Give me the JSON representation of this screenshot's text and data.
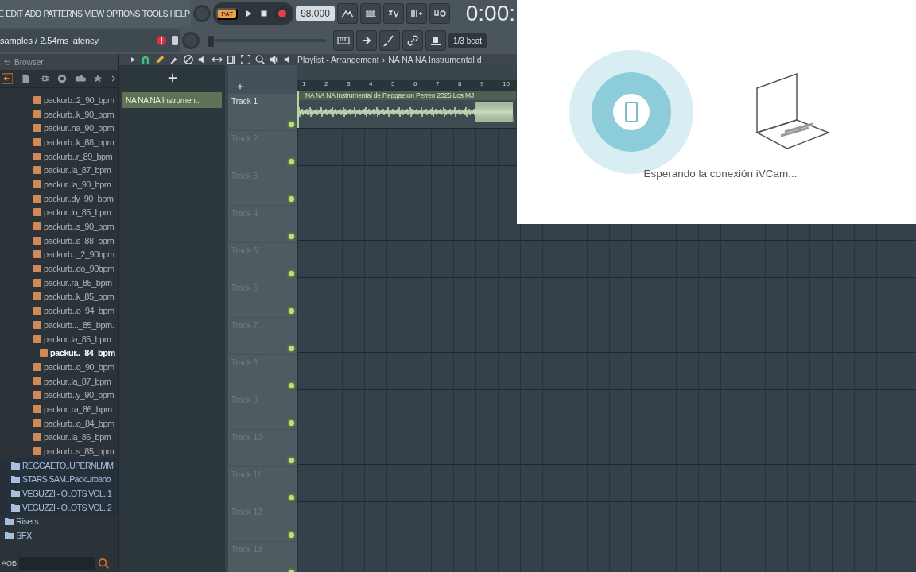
{
  "menu": {
    "items": [
      "E",
      "EDIT",
      "ADD",
      "PATTERNS",
      "VIEW",
      "OPTIONS",
      "TOOLS",
      "HELP"
    ]
  },
  "hint_bar": {
    "text": "samples / 2.54ms latency"
  },
  "master_slider": {
    "level": 0.0
  },
  "transport": {
    "mode": "PAT",
    "tempo": "98.000",
    "time": "0:00:",
    "snap": "1/3 beat"
  },
  "browser": {
    "title": "Browser",
    "search": "AOB",
    "items": [
      {
        "kind": "sample",
        "label": "packurb..2_90_bpm",
        "selected": false
      },
      {
        "kind": "sample",
        "label": "packurb..k_90_bpm",
        "selected": false
      },
      {
        "kind": "sample",
        "label": "packur..na_90_bpm",
        "selected": false
      },
      {
        "kind": "sample",
        "label": "packurb..k_88_bpm",
        "selected": false
      },
      {
        "kind": "sample",
        "label": "packurb..r_89_bpm",
        "selected": false
      },
      {
        "kind": "sample",
        "label": "packur..la_87_bpm",
        "selected": false
      },
      {
        "kind": "sample",
        "label": "packur..la_90_bpm",
        "selected": false
      },
      {
        "kind": "sample",
        "label": "packur..dy_90_bpm",
        "selected": false
      },
      {
        "kind": "sample",
        "label": "packur..lo_85_bpm",
        "selected": false
      },
      {
        "kind": "sample",
        "label": "packurb..s_90_bpm",
        "selected": false
      },
      {
        "kind": "sample",
        "label": "packurb..s_88_bpm",
        "selected": false
      },
      {
        "kind": "sample",
        "label": "packurb.._2_90bpm",
        "selected": false
      },
      {
        "kind": "sample",
        "label": "packurb..do_90bpm",
        "selected": false
      },
      {
        "kind": "sample",
        "label": "packur..ra_85_bpm",
        "selected": false
      },
      {
        "kind": "sample",
        "label": "packurb..k_85_bpm",
        "selected": false
      },
      {
        "kind": "sample",
        "label": "packurb..o_94_bpm",
        "selected": false
      },
      {
        "kind": "sample",
        "label": "packurb..._85_bpm.",
        "selected": false
      },
      {
        "kind": "sample",
        "label": "packur..la_85_bpm",
        "selected": false
      },
      {
        "kind": "sample",
        "label": "packur.._84_bpm",
        "selected": true
      },
      {
        "kind": "sample",
        "label": "packurb..o_90_bpm",
        "selected": false
      },
      {
        "kind": "sample",
        "label": "packur..la_87_bpm",
        "selected": false
      },
      {
        "kind": "sample",
        "label": "packurb..y_90_bpm",
        "selected": false
      },
      {
        "kind": "sample",
        "label": "packur..ra_86_bpm",
        "selected": false
      },
      {
        "kind": "sample",
        "label": "packurb..o_84_bpm",
        "selected": false
      },
      {
        "kind": "sample",
        "label": "packur..la_86_bpm",
        "selected": false
      },
      {
        "kind": "sample",
        "label": "packurb..s_85_bpm",
        "selected": false
      },
      {
        "kind": "folder",
        "label": "REGGAETO..UPERNLMM",
        "selected": false
      },
      {
        "kind": "folder",
        "label": "STARS SAM..PackUrbano",
        "selected": false
      },
      {
        "kind": "folder",
        "label": "VEGUZZI - O..OTS VOL. 1",
        "selected": false
      },
      {
        "kind": "folder",
        "label": "VEGUZZI - O..OTS VOL. 2",
        "selected": false
      },
      {
        "kind": "category",
        "label": "Risers",
        "selected": false
      },
      {
        "kind": "category",
        "label": "SFX",
        "selected": false
      }
    ]
  },
  "patterns": {
    "items": [
      {
        "label": "NA NA NA  Instrumen...",
        "selected": true
      }
    ]
  },
  "playlist": {
    "title": "Playlist - Arrangement",
    "separator": "›",
    "breadcrumb": "NA NA NA  Instrumental d",
    "ruler": [
      "1",
      "2",
      "3",
      "4",
      "5",
      "6",
      "7",
      "8",
      "9",
      "10"
    ],
    "clip": {
      "title": "NA NA NA  Instrumental de Reggaeton Perreo 2025  Los MJ"
    },
    "tracks": [
      "Track 1",
      "Track 2",
      "Track 3",
      "Track 4",
      "Track 5",
      "Track 6",
      "Track 7",
      "Track 8",
      "Track 9",
      "Track 10",
      "Track 11",
      "Track 12",
      "Track 13"
    ]
  },
  "ivcam": {
    "status": "Esperando la conexión iVCam..."
  }
}
